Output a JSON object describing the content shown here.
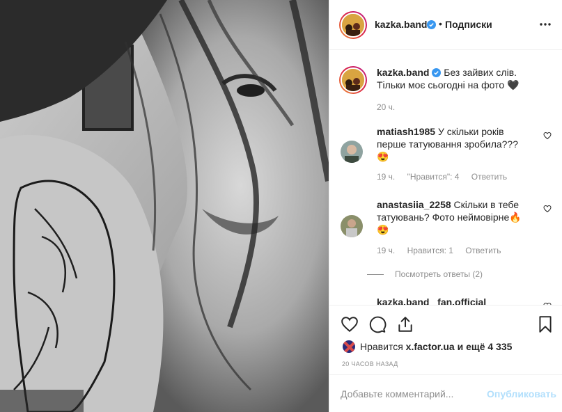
{
  "post": {
    "author": "kazka.band",
    "follow_label": "Подписки",
    "separator": "•",
    "more_icon": "more-horizontal-icon",
    "photo_alt": "Black and white selfie"
  },
  "caption": {
    "author": "kazka.band",
    "text": "Без зайвих слів. Тільки моє сьогодні на фото 🖤",
    "time": "20 ч."
  },
  "comments": [
    {
      "author": "matiash1985",
      "text": "У скільки років перше татуювання зробила???",
      "emoji": "😍",
      "time": "19 ч.",
      "likes": "\"Нравится\": 4",
      "reply": "Ответить"
    },
    {
      "author": "anastasiia_2258",
      "text": "Скільки в тебе татуювань? Фото неймовірне🔥",
      "emoji": "😍",
      "time": "19 ч.",
      "likes": "Нравится: 1",
      "reply": "Ответить",
      "view_replies": "Посмотреть ответы (2)"
    },
    {
      "author": "kazka.band",
      "text": "_fan.official"
    }
  ],
  "likes": {
    "prefix": "Нравится",
    "user": "x.factor.ua",
    "suffix": "и ещё 4 335"
  },
  "timestamp": "20 часов назад",
  "add_comment": {
    "placeholder": "Добавьте комментарий...",
    "publish_label": "Опубликовать"
  },
  "colors": {
    "text": "#262626",
    "secondary": "#8e8e8e",
    "verified": "#3897f0",
    "publish_disabled": "#b2dffc"
  }
}
